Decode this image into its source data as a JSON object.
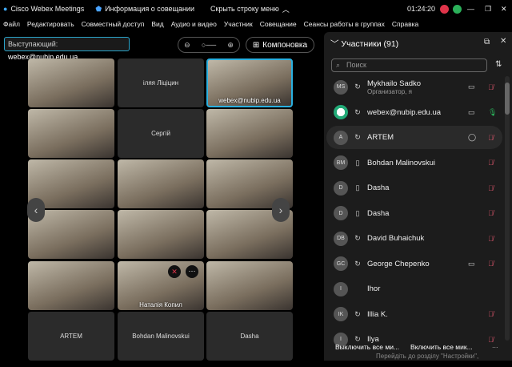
{
  "titlebar": {
    "app": "Cisco Webex Meetings",
    "info": "Информация о совещании",
    "hide_menu": "Скрыть строку меню",
    "time": "01:24:20"
  },
  "menu": [
    "Файл",
    "Редактировать",
    "Совместный доступ",
    "Вид",
    "Аудио и видео",
    "Участник",
    "Совещание",
    "Сеансы работы в группах",
    "Справка"
  ],
  "toolbar": {
    "presenter_label": "Выступающий:",
    "presenter": "webex@nubip.edu.ua",
    "layout": "Компоновка"
  },
  "tiles": [
    {
      "name": "",
      "video": true
    },
    {
      "name": "іляя Ліціцин",
      "video": false
    },
    {
      "name": "webex@nubip.edu.ua",
      "video": true,
      "active": true
    },
    {
      "name": "",
      "video": true
    },
    {
      "name": "Сергій",
      "video": false
    },
    {
      "name": "",
      "video": true
    },
    {
      "name": "",
      "video": true
    },
    {
      "name": "",
      "video": true
    },
    {
      "name": "",
      "video": true
    },
    {
      "name": "",
      "video": true
    },
    {
      "name": "",
      "video": true
    },
    {
      "name": "",
      "video": true
    },
    {
      "name": "",
      "video": true
    },
    {
      "name": "Наталія Копил",
      "video": true
    },
    {
      "name": "",
      "video": true
    },
    {
      "name": "ARTEM",
      "video": false
    },
    {
      "name": "Bohdan Malinovskui",
      "video": false
    },
    {
      "name": "Dasha",
      "video": false
    }
  ],
  "panel": {
    "title": "Участники (91)",
    "search_placeholder": "Поиск",
    "participants": [
      {
        "initials": "MS",
        "name": "Mykhailo Sadko",
        "role": "Организатор, я",
        "device": "headset",
        "video": true,
        "mic": "muted"
      },
      {
        "initials": "",
        "name": "webex@nubip.edu.ua",
        "role": "",
        "device": "headset",
        "video": true,
        "mic": "on"
      },
      {
        "initials": "A",
        "name": "ARTEM",
        "role": "",
        "device": "headset",
        "chat": true,
        "mic": "muted"
      },
      {
        "initials": "BM",
        "name": "Bohdan Malinovskui",
        "role": "",
        "device": "phone",
        "mic": "muted"
      },
      {
        "initials": "D",
        "name": "Dasha",
        "role": "",
        "device": "phone",
        "mic": "muted"
      },
      {
        "initials": "D",
        "name": "Dasha",
        "role": "",
        "device": "phone",
        "mic": "muted"
      },
      {
        "initials": "DB",
        "name": "David Buhaichuk",
        "role": "",
        "device": "headset",
        "mic": "muted"
      },
      {
        "initials": "GC",
        "name": "George Chepenko",
        "role": "",
        "device": "headset",
        "video": true,
        "mic": "muted"
      },
      {
        "initials": "I",
        "name": "Ihor",
        "role": "",
        "device": "none",
        "mic": "none"
      },
      {
        "initials": "IK",
        "name": "Illia K.",
        "role": "",
        "device": "headset",
        "mic": "muted"
      },
      {
        "initials": "I",
        "name": "Ilya",
        "role": "",
        "device": "headset",
        "mic": "muted"
      }
    ],
    "mute_all": "Выключить все ми...",
    "unmute_all": "Включить все мик...",
    "more": "..."
  },
  "watermark": "Перейдіть до розділу \"Настройки\","
}
